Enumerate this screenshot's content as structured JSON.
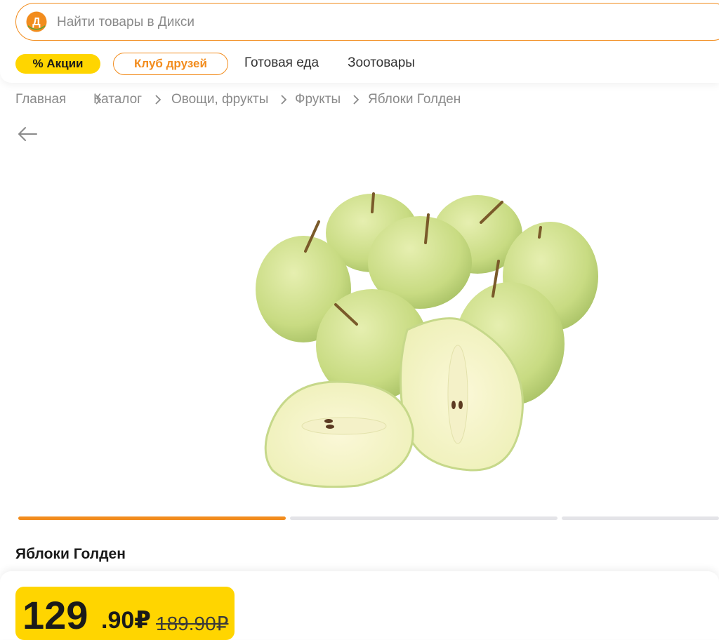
{
  "search": {
    "placeholder": "Найти товары в Дикси"
  },
  "logo": {
    "letter": "Д"
  },
  "nav": {
    "promo": "% Акции",
    "club": "Клуб друзей",
    "links": [
      "Готовая еда",
      "Зоотовары"
    ]
  },
  "breadcrumb": [
    "Главная",
    "Каталог",
    "Овощи, фрукты",
    "Фрукты",
    "Яблоки Голден"
  ],
  "gallery": {
    "active_slide": 1,
    "total_slides": 3
  },
  "product": {
    "title": "Яблоки Голден",
    "price_int": "129",
    "price_frac": ".90₽",
    "price_old": "189.90₽"
  },
  "colors": {
    "accent": "#f28c1d",
    "promo_yellow": "#ffd500",
    "logo_green": "#56a73a",
    "apple": "#cfe08a"
  }
}
